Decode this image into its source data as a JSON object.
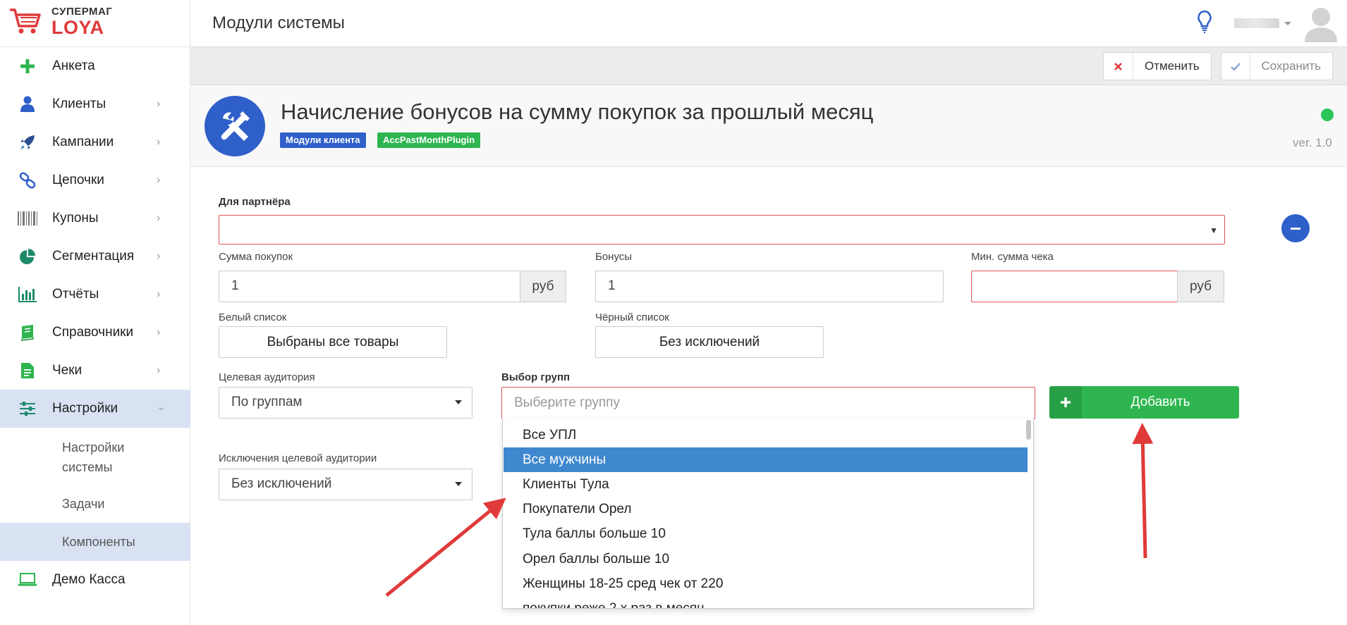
{
  "brand": {
    "line1": "СУПЕРМАГ",
    "line2": "LOYA"
  },
  "header": {
    "title": "Модули системы"
  },
  "sidebar": {
    "items": [
      {
        "label": "Анкета",
        "icon": "plus-icon"
      },
      {
        "label": "Клиенты",
        "icon": "user-icon"
      },
      {
        "label": "Кампании",
        "icon": "rocket-icon"
      },
      {
        "label": "Цепочки",
        "icon": "link-icon"
      },
      {
        "label": "Купоны",
        "icon": "barcode-icon"
      },
      {
        "label": "Сегментация",
        "icon": "pie-icon"
      },
      {
        "label": "Отчёты",
        "icon": "bar-chart-icon"
      },
      {
        "label": "Справочники",
        "icon": "book-icon"
      },
      {
        "label": "Чеки",
        "icon": "document-icon"
      },
      {
        "label": "Настройки",
        "icon": "sliders-icon"
      },
      {
        "label": "Демо Касса",
        "icon": "laptop-icon"
      }
    ],
    "subitems": [
      {
        "label": "Настройки системы"
      },
      {
        "label": "Задачи"
      },
      {
        "label": "Компоненты"
      }
    ]
  },
  "toolbar": {
    "cancel_label": "Отменить",
    "save_label": "Сохранить"
  },
  "module": {
    "title": "Начисление бонусов на сумму покупок за прошлый месяц",
    "badge1": "Модули клиента",
    "badge2": "AccPastMonthPlugin",
    "version": "ver. 1.0"
  },
  "form": {
    "partner_label": "Для партнёра",
    "sum_label": "Сумма покупок",
    "sum_value": "1",
    "sum_unit": "руб",
    "bonus_label": "Бонусы",
    "bonus_value": "1",
    "minsum_label": "Мин. сумма чека",
    "minsum_unit": "руб",
    "whitelist_label": "Белый список",
    "whitelist_value": "Выбраны все товары",
    "blacklist_label": "Чёрный список",
    "blacklist_value": "Без исключений",
    "audience_label": "Целевая аудитория",
    "audience_value": "По группам",
    "groups_label": "Выбор групп",
    "groups_placeholder": "Выберите группу",
    "add_label": "Добавить",
    "exclusions_label": "Исключения целевой аудитории",
    "exclusions_value": "Без исключений"
  },
  "dropdown": {
    "options": [
      "Все УПЛ",
      "Все мужчины",
      "Клиенты Тула",
      "Покупатели Орел",
      "Тула баллы больше 10",
      "Орел баллы больше 10",
      "Женщины 18-25 сред чек от 220",
      "покупки реже 2 х раз в месяц"
    ],
    "highlighted": "Все мужчины"
  },
  "colors": {
    "accent": "#2f5fc9",
    "success": "#2eb54f",
    "danger": "#e05454",
    "highlight": "#3f88cf",
    "brand_red": "#e03a3a"
  }
}
